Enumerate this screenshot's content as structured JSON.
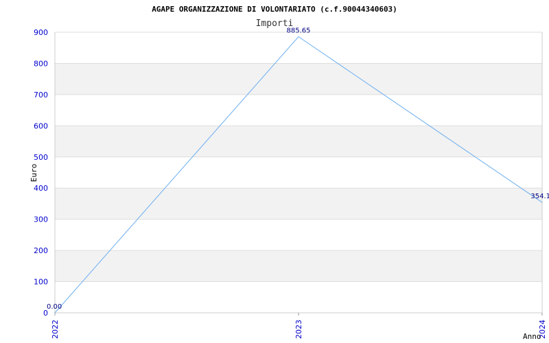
{
  "chart_data": {
    "type": "line",
    "title": "AGAPE ORGANIZZAZIONE DI VOLONTARIATO (c.f.90044340603)",
    "subtitle": "Importi",
    "xlabel": "Anno",
    "ylabel": "Euro",
    "categories": [
      "2022",
      "2023",
      "2024"
    ],
    "series": [
      {
        "values": [
          0.0,
          885.65,
          354.1
        ]
      }
    ],
    "data_labels": [
      "0.00",
      "885.65",
      "354.1"
    ],
    "ylim": [
      0,
      900
    ],
    "yticks": [
      0,
      100,
      200,
      300,
      400,
      500,
      600,
      700,
      800,
      900
    ],
    "grid": true,
    "colors": {
      "line": "#6aaef0",
      "band": "#f2f2f2",
      "grid": "#dddddd",
      "tick_text": "#0000cc",
      "data_label": "#000080"
    }
  }
}
